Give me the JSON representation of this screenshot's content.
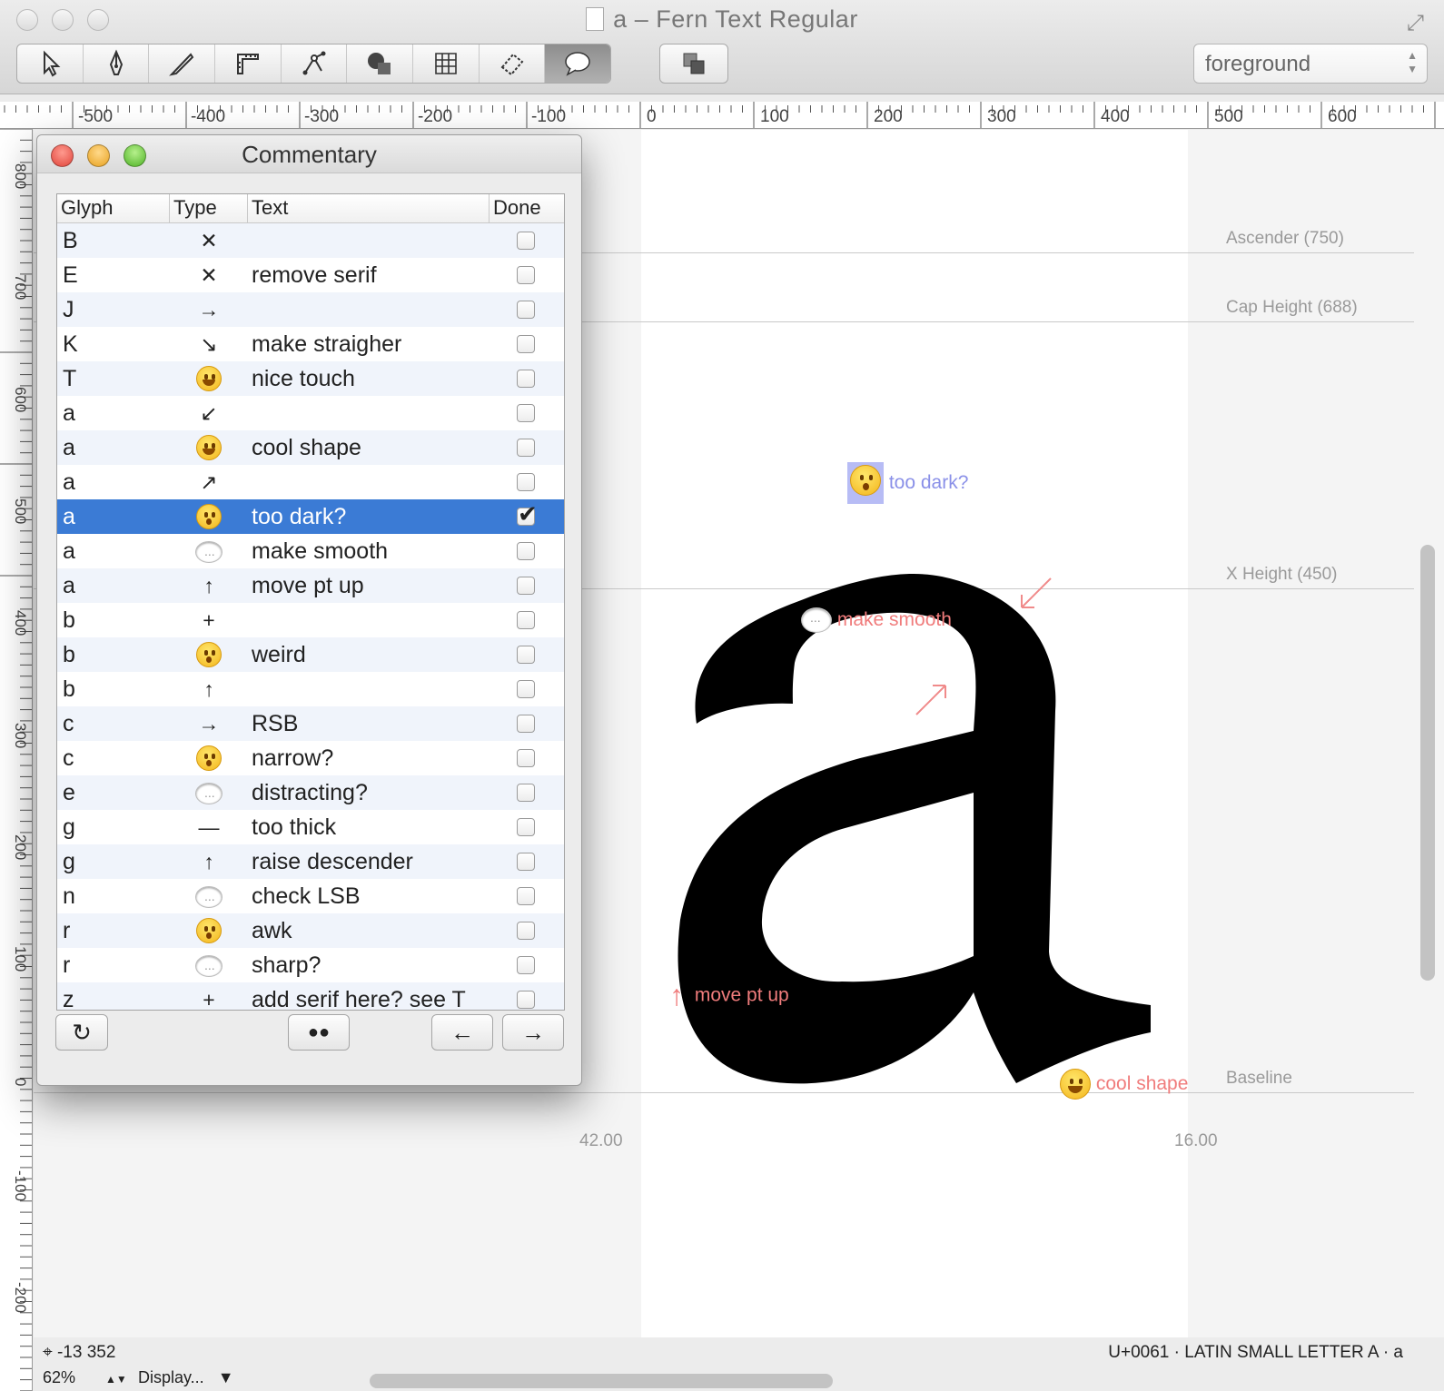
{
  "window": {
    "title": "a – Fern Text Regular"
  },
  "toolbar": {
    "tools": [
      {
        "icon": "pointer-icon"
      },
      {
        "icon": "pen-icon"
      },
      {
        "icon": "knife-icon"
      },
      {
        "icon": "measure-icon"
      },
      {
        "icon": "nodes-icon"
      },
      {
        "icon": "shapes-icon"
      },
      {
        "icon": "grid-icon"
      },
      {
        "icon": "eraser-icon"
      },
      {
        "icon": "comment-icon"
      }
    ],
    "layer_select": "foreground"
  },
  "ruler": {
    "horizontal": [
      "-500",
      "-400",
      "-300",
      "-200",
      "-100",
      "0",
      "100",
      "200",
      "300",
      "400",
      "500",
      "600"
    ],
    "vertical": [
      "800",
      "700",
      "600",
      "500",
      "400",
      "300",
      "200",
      "100",
      "0",
      "-100",
      "-200"
    ]
  },
  "guides": {
    "ascender": "Ascender (750)",
    "cap_height": "Cap Height (688)",
    "x_height": "X Height (450)",
    "baseline": "Baseline"
  },
  "metrics": {
    "lsb": "42.00",
    "rsb": "16.00"
  },
  "canvas_notes": {
    "too_dark": "too dark?",
    "make_smooth": "make smooth",
    "move_pt_up": "move pt up",
    "cool_shape": "cool shape"
  },
  "commentary": {
    "title": "Commentary",
    "columns": {
      "glyph": "Glyph",
      "type": "Type",
      "text": "Text",
      "done": "Done"
    },
    "rows": [
      {
        "glyph": "B",
        "type": "✕",
        "text": "",
        "done": false
      },
      {
        "glyph": "E",
        "type": "✕",
        "text": "remove serif",
        "done": false
      },
      {
        "glyph": "J",
        "type": "→",
        "text": "",
        "done": false
      },
      {
        "glyph": "K",
        "type": "↘",
        "text": "make straigher",
        "done": false
      },
      {
        "glyph": "T",
        "type": "smile",
        "text": "nice touch",
        "done": false
      },
      {
        "glyph": "a",
        "type": "↙",
        "text": "",
        "done": false
      },
      {
        "glyph": "a",
        "type": "smile",
        "text": "cool shape",
        "done": false
      },
      {
        "glyph": "a",
        "type": "↗",
        "text": "",
        "done": false
      },
      {
        "glyph": "a",
        "type": "surprise",
        "text": "too dark?",
        "done": true,
        "selected": true
      },
      {
        "glyph": "a",
        "type": "bubble",
        "text": "make smooth",
        "done": false
      },
      {
        "glyph": "a",
        "type": "↑",
        "text": "move pt up",
        "done": false
      },
      {
        "glyph": "b",
        "type": "+",
        "text": "",
        "done": false
      },
      {
        "glyph": "b",
        "type": "surprise",
        "text": "weird",
        "done": false
      },
      {
        "glyph": "b",
        "type": "↑",
        "text": "",
        "done": false
      },
      {
        "glyph": "c",
        "type": "→",
        "text": "RSB",
        "done": false
      },
      {
        "glyph": "c",
        "type": "surprise",
        "text": "narrow?",
        "done": false
      },
      {
        "glyph": "e",
        "type": "bubble",
        "text": "distracting?",
        "done": false
      },
      {
        "glyph": "g",
        "type": "—",
        "text": "too thick",
        "done": false
      },
      {
        "glyph": "g",
        "type": "↑",
        "text": "raise descender",
        "done": false
      },
      {
        "glyph": "n",
        "type": "bubble",
        "text": "check LSB",
        "done": false
      },
      {
        "glyph": "r",
        "type": "surprise",
        "text": "awk",
        "done": false
      },
      {
        "glyph": "r",
        "type": "bubble",
        "text": "sharp?",
        "done": false
      },
      {
        "glyph": "z",
        "type": "+",
        "text": "add serif here? see T",
        "done": false
      }
    ],
    "buttons": {
      "refresh": "↻",
      "eyes": "👀",
      "prev": "←",
      "next": "→"
    }
  },
  "status": {
    "coords": "⌖ -13 352",
    "unicode": "U+0061 · LATIN SMALL LETTER A · a",
    "zoom": "62%",
    "display": "Display..."
  }
}
